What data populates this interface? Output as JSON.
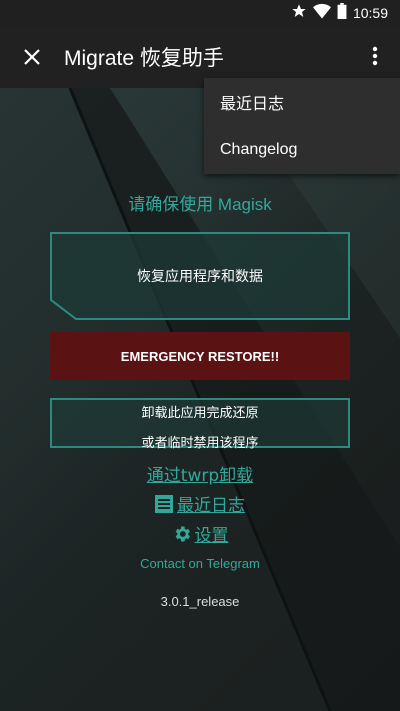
{
  "status": {
    "time": "10:59",
    "icons": [
      "star-icon",
      "wifi-icon",
      "battery-icon"
    ]
  },
  "appbar": {
    "title": "Migrate 恢复助手"
  },
  "menu": {
    "items": [
      {
        "label": "最近日志"
      },
      {
        "label": "Changelog"
      }
    ]
  },
  "main": {
    "headline": "请确保使用 Magisk",
    "restore_button": "恢复应用程序和数据",
    "emergency_button": "EMERGENCY RESTORE!!",
    "uninstall_line1": "卸载此应用完成还原",
    "uninstall_line2": "或者临时禁用该程序",
    "twrp_link": "通过twrp卸载",
    "logs_link": "最近日志",
    "settings_link": "设置",
    "telegram_link": "Contact on Telegram",
    "version": "3.0.1_release"
  },
  "colors": {
    "accent": "#33a89a",
    "emergency": "#5a1212",
    "appbar": "#212121"
  }
}
